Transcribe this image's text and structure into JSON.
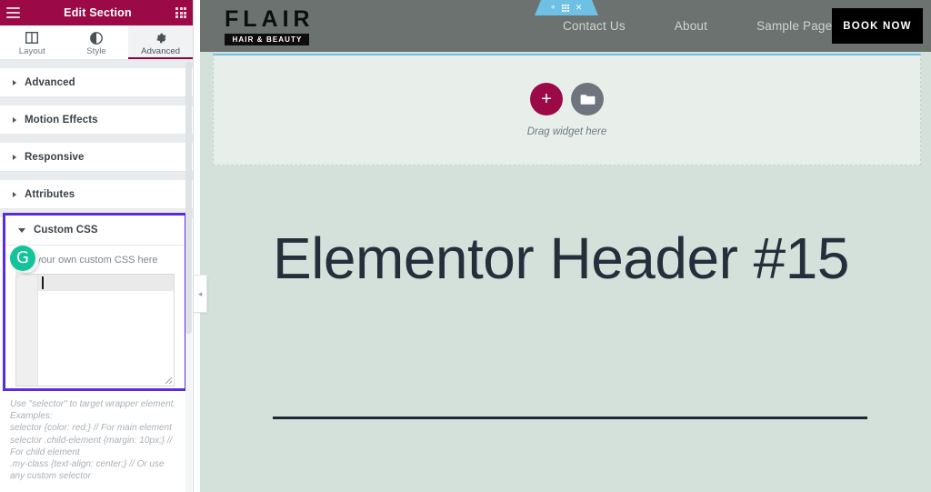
{
  "panel": {
    "header": {
      "title": "Edit Section",
      "menu_icon": "hamburger-icon",
      "widgets_icon": "grid-icon"
    },
    "tabs": [
      {
        "label": "Layout",
        "icon": "columns-icon",
        "active": false
      },
      {
        "label": "Style",
        "icon": "contrast-icon",
        "active": false
      },
      {
        "label": "Advanced",
        "icon": "gear-icon",
        "active": true
      }
    ],
    "sections": [
      {
        "label": "Advanced",
        "open": false
      },
      {
        "label": "Motion Effects",
        "open": false
      },
      {
        "label": "Responsive",
        "open": false
      },
      {
        "label": "Attributes",
        "open": false
      }
    ],
    "custom_css": {
      "label": "Custom CSS",
      "open": true,
      "field_label": "Add your own custom CSS here",
      "editor_value": "",
      "highlight_color": "#5b2be0",
      "grammarly_badge": "grammarly-icon",
      "help_text": "Use \"selector\" to target wrapper element. Examples:\nselector {color: red;} // For main element\nselector .child-element {margin: 10px;} // For child element\n.my-class {text-align: center;} // Or use any custom selector"
    },
    "collapse_handle": "◂"
  },
  "preview": {
    "site": {
      "logo_word": "FLAIR",
      "logo_tagline": "HAIR & BEAUTY",
      "nav_links": [
        "Contact Us",
        "About",
        "Sample Page"
      ],
      "cta_label": "BOOK NOW"
    },
    "section_toolbar": {
      "add_icon": "plus-icon",
      "columns_icon": "grid-icon",
      "close_icon": "close-icon"
    },
    "empty_section": {
      "add_widget_icon": "plus-circle-icon",
      "template_icon": "folder-icon",
      "drop_text": "Drag widget here"
    },
    "hero": {
      "title": "Elementor Header #15"
    }
  },
  "colors": {
    "panel_header": "#9b0a46",
    "accent_red": "#93003f",
    "highlight_purple": "#5b2be0",
    "nav_bg": "#6b7270",
    "section_tab_blue": "#6ec1e4",
    "hero_bg": "#d4e0da",
    "hero_text": "#242f3b",
    "grammarly_green": "#15c39a"
  }
}
